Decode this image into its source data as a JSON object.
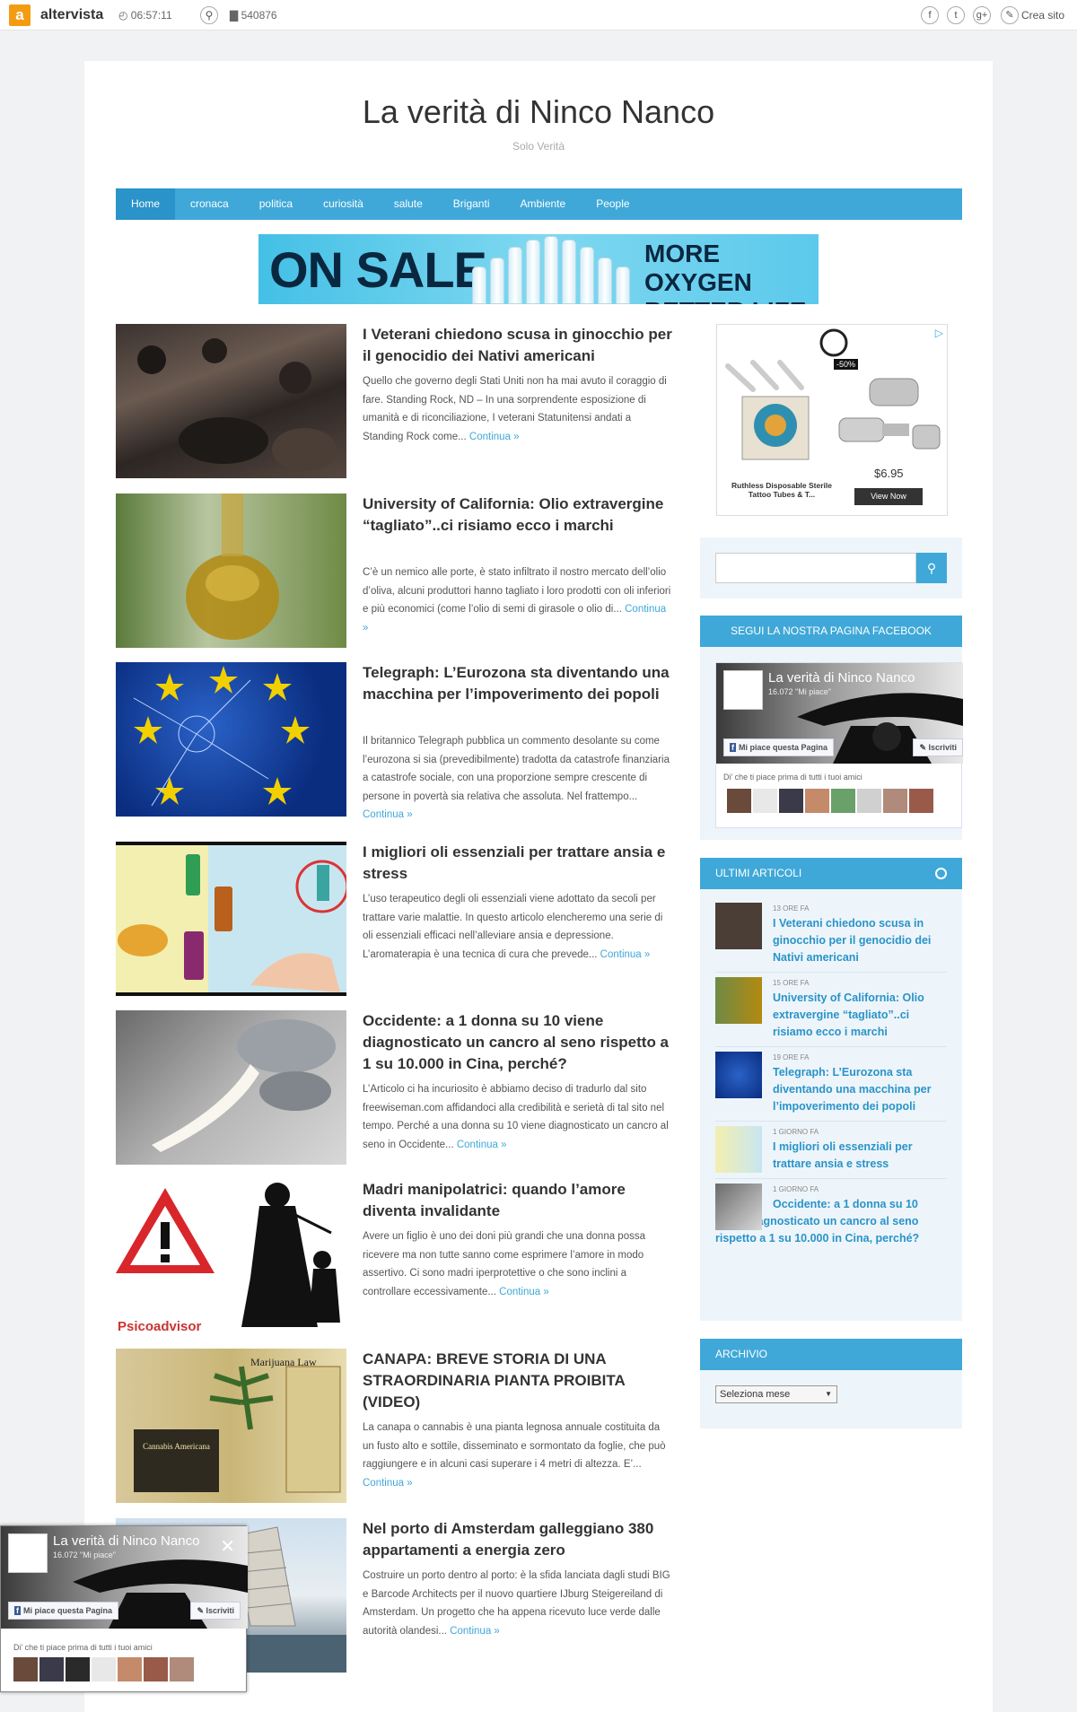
{
  "topbar": {
    "logo_letter": "a",
    "logo_text": "altervista",
    "clock": "◴ 06:57:11",
    "visits": "▇ 540876",
    "crea_sito": "Crea sito",
    "social_icons": [
      "f",
      "t",
      "g+"
    ]
  },
  "site": {
    "title": "La verità di Ninco Nanco",
    "tagline": "Solo Verità"
  },
  "nav": [
    "Home",
    "cronaca",
    "politica",
    "curiosità",
    "salute",
    "Briganti",
    "Ambiente",
    "People"
  ],
  "banner": {
    "left": "ON SALE",
    "right_line1": "MORE OXYGEN",
    "right_line2": "BETTER LIFE"
  },
  "posts": [
    {
      "title": "I Veterani chiedono scusa in ginocchio per il genocidio dei Nativi americani",
      "excerpt": "Quello che governo degli Stati Uniti non ha mai avuto il coraggio di fare. Standing Rock, ND – In una sorprendente esposizione di umanità e di riconciliazione, I veterani Statunitensi andati a Standing Rock come...",
      "more": "Continua »"
    },
    {
      "title": "University of California: Olio extravergine “tagliato”..ci risiamo ecco i marchi",
      "excerpt": "C’è un nemico alle porte, è stato infiltrato il nostro mercato dell’olio d’oliva, alcuni produttori hanno tagliato i loro prodotti con oli inferiori e più economici (come l’olio di semi di girasole o olio di...",
      "more": "Continua »"
    },
    {
      "title": "Telegraph: L’Eurozona sta diventando una macchina per l’impoverimento dei popoli",
      "excerpt": "Il britannico Telegraph pubblica un commento desolante su come l’eurozona si sia (prevedibilmente) tradotta da catastrofe finanziaria a catastrofe sociale, con una proporzione sempre crescente di persone in povertà sia relativa che assoluta. Nel frattempo...",
      "more": "Continua »"
    },
    {
      "title": "I migliori oli essenziali per trattare ansia e stress",
      "excerpt": "L’uso terapeutico degli oli essenziali viene adottato da secoli per trattare varie malattie. In questo articolo elencheremo una serie di oli essenziali efficaci nell’alleviare ansia e depressione. L’aromaterapia è una tecnica di cura che prevede...",
      "more": "Continua »"
    },
    {
      "title": "Occidente: a 1 donna su 10 viene diagnosticato un cancro al seno rispetto a 1 su 10.000 in Cina, perché?",
      "excerpt": "L’Articolo ci ha incuriosito è abbiamo deciso di tradurlo dal sito freewiseman.com affidandoci alla credibilità e serietà di tal sito nel tempo. Perché a una donna su 10 viene diagnosticato un cancro al seno in Occidente...",
      "more": "Continua »"
    },
    {
      "title": "Madri manipolatrici: quando l’amore diventa invalidante",
      "excerpt": "Avere un figlio è uno dei doni più grandi che una donna possa ricevere ma non tutte sanno come esprimere l’amore in modo assertivo. Ci sono madri iperprotettive o che sono inclini a controllare eccessivamente...",
      "more": "Continua »"
    },
    {
      "title": "CANAPA: BREVE STORIA DI UNA STRAORDINARIA PIANTA PROIBITA (VIDEO)",
      "excerpt": "La canapa o cannabis è una pianta legnosa annuale costituita da un fusto alto e sottile, disseminato e sormontato da foglie, che può raggiungere e in alcuni casi superare i 4 metri di altezza. E’...",
      "more": "Continua »"
    },
    {
      "title": "Nel porto di Amsterdam galleggiano 380 appartamenti a energia zero",
      "excerpt": "Costruire un porto dentro al porto: è la sfida lanciata dagli studi BIG e Barcode Architects per il nuovo quartiere IJburg Steigereiland di Amsterdam. Un progetto che ha appena ricevuto luce verde dalle autorità olandesi...",
      "more": "Continua »"
    }
  ],
  "post_thumb_text": {
    "madri_logo": "Psicoadvisor",
    "canapa_heading": "Marijuana Law",
    "canapa_label": "Cannabis Americana"
  },
  "ad": {
    "badge": "-50%",
    "product": "Ruthless Disposable Sterile Tattoo Tubes & T...",
    "price": "$6.95",
    "cta": "View Now",
    "adchoice": "▷"
  },
  "search": {
    "placeholder": "",
    "icon": "⚲"
  },
  "facebook": {
    "heading": "SEGUI LA NOSTRA PAGINA FACEBOOK",
    "page_name": "La verità di Ninco Nanco",
    "likes": "16.072 \"Mi piace\"",
    "like_button": "Mi piace questa Pagina",
    "subscribe": "✎ Iscriviti",
    "friends_text": "Di’ che ti piace prima di tutti i tuoi amici"
  },
  "ultimi": {
    "heading": "ULTIMI ARTICOLI",
    "items": [
      {
        "time": "13 ORE FA",
        "title": "I Veterani chiedono scusa in ginocchio per il genocidio dei Nativi americani"
      },
      {
        "time": "15 ORE FA",
        "title": "University of California: Olio extravergine “tagliato”..ci risiamo ecco i marchi"
      },
      {
        "time": "19 ORE FA",
        "title": "Telegraph: L’Eurozona sta diventando una macchina per l’impoverimento dei popoli"
      },
      {
        "time": "1 GIORNO FA",
        "title": "I migliori oli essenziali per trattare ansia e stress"
      },
      {
        "time": "1 GIORNO FA",
        "title": "Occidente: a 1 donna su 10 viene diagnosticato un cancro al seno rispetto a 1 su 10.000 in Cina, perché?"
      }
    ]
  },
  "archivio": {
    "heading": "ARCHIVIO",
    "select": "Seleziona mese"
  },
  "fbpopup": {
    "close": "✕"
  },
  "colors": {
    "accent": "#3fa8d8",
    "nav_active": "#2a93c9",
    "logo": "#f39c12"
  }
}
